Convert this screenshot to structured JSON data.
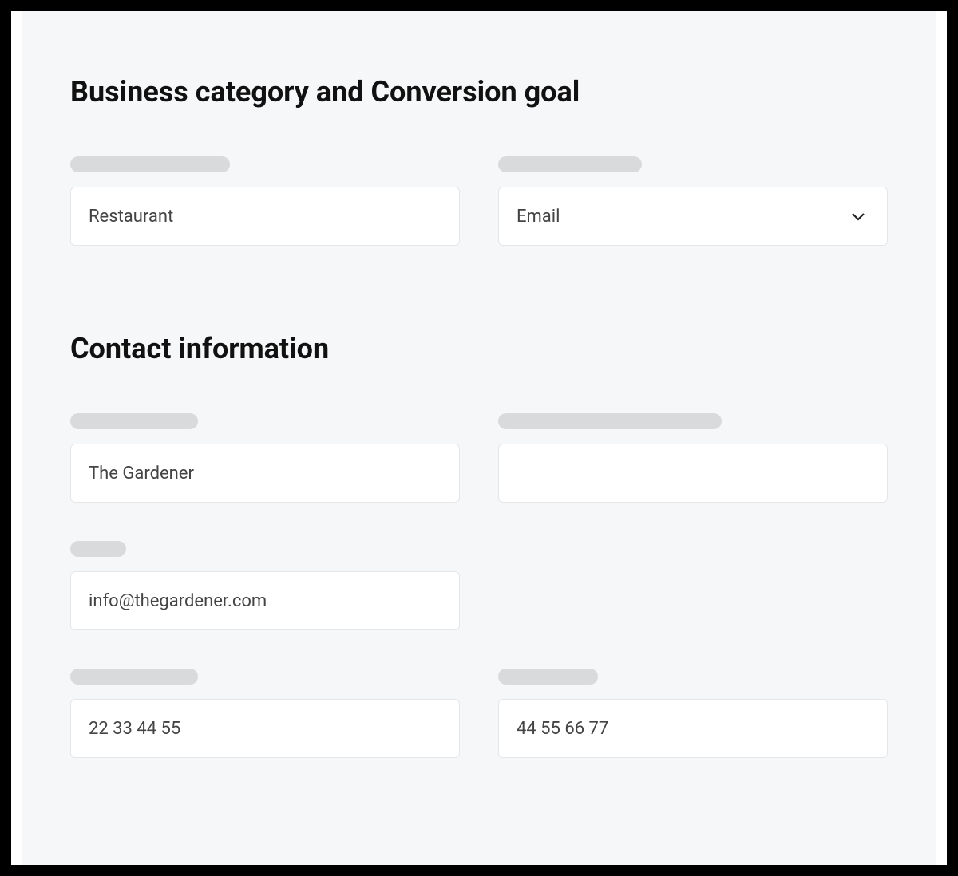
{
  "sections": {
    "business": {
      "heading": "Business category and Conversion goal",
      "category_value": "Restaurant",
      "goal_value": "Email"
    },
    "contact": {
      "heading": "Contact information",
      "name_value": "The Gardener",
      "other_value": "",
      "email_value": "info@thegardener.com",
      "phone1_value": "22 33 44 55",
      "phone2_value": "44 55 66 77"
    }
  }
}
